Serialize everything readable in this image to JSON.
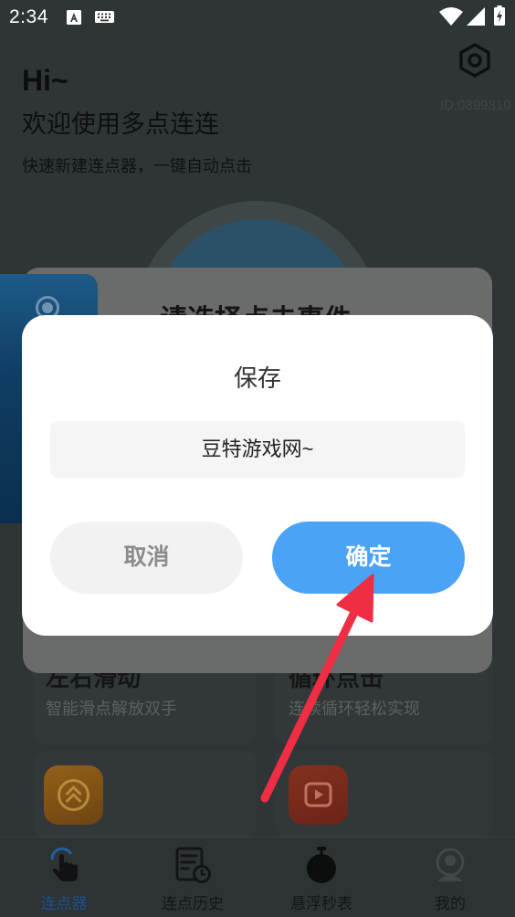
{
  "status_bar": {
    "time": "2:34",
    "icons": [
      "text-a-icon",
      "keyboard-icon",
      "wifi-icon",
      "signal-icon",
      "battery-charging-icon"
    ]
  },
  "home": {
    "greeting": "Hi~",
    "welcome": "欢迎使用多点连连",
    "subtitle": "快速新建连点器，一键自动点击",
    "user_id": "ID:0899310",
    "settings_icon": "settings-hex-icon"
  },
  "event_panel": {
    "title": "请选择点击事件"
  },
  "features": [
    {
      "title": "左右滑动",
      "desc": "智能滑点解放双手"
    },
    {
      "title": "循环点击",
      "desc": "连续循环轻松实现"
    },
    {
      "icon": "double-chevron-up-icon",
      "color": "#8c5b18"
    },
    {
      "icon": "play-icon",
      "color": "#7a2c1e"
    }
  ],
  "save_dialog": {
    "title": "保存",
    "input_value": "豆特游戏网~",
    "cancel_label": "取消",
    "confirm_label": "确定"
  },
  "bottom_nav": [
    {
      "label": "连点器",
      "icon": "tap-hand-icon",
      "active": true
    },
    {
      "label": "连点历史",
      "icon": "history-doc-icon",
      "active": false
    },
    {
      "label": "悬浮秒表",
      "icon": "stopwatch-icon",
      "active": false
    },
    {
      "label": "我的",
      "icon": "profile-icon",
      "active": false
    }
  ],
  "colors": {
    "accent": "#4aa3f7",
    "annotation_arrow": "#ef2d43",
    "nav_active": "#1d4f8c"
  }
}
